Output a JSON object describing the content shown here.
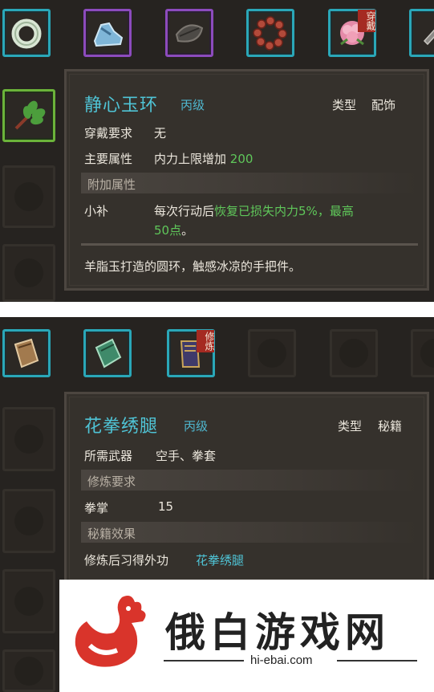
{
  "panel1": {
    "top_slots": [
      {
        "icon": "jade-ring-icon",
        "frame": "cyan"
      },
      {
        "icon": "blue-shoe-icon",
        "frame": "purple"
      },
      {
        "icon": "dark-stone-icon",
        "frame": "purple"
      },
      {
        "icon": "prayer-beads-icon",
        "frame": "cyan"
      },
      {
        "icon": "pink-flower-icon",
        "frame": "cyan",
        "tag": "穿戴"
      },
      {
        "icon": "gray-item-icon",
        "frame": "cyan"
      }
    ],
    "side_slots": [
      {
        "icon": "green-herb-icon",
        "frame": "green"
      },
      {
        "icon": "",
        "frame": "empty"
      },
      {
        "icon": "",
        "frame": "empty"
      }
    ],
    "tooltip": {
      "name": "静心玉环",
      "grade": "丙级",
      "type_label": "类型",
      "type_value": "配饰",
      "req_label": "穿戴要求",
      "req_value": "无",
      "main_attr_label": "主要属性",
      "main_attr_text": "内力上限增加",
      "main_attr_value": "200",
      "extra_header": "附加属性",
      "extra_name": "小补",
      "extra_desc_prefix": "每次行动后",
      "extra_desc_green1": "恢复已损失内力5%，最高",
      "extra_desc_green2": "50点",
      "extra_desc_suffix": "。",
      "description": "羊脂玉打造的圆环，触感冰凉的手把件。"
    }
  },
  "panel2": {
    "top_slots": [
      {
        "icon": "brown-book-icon",
        "frame": "cyan"
      },
      {
        "icon": "green-book-icon",
        "frame": "cyan"
      },
      {
        "icon": "purple-book-icon",
        "frame": "cyan",
        "tag": "修炼"
      },
      {
        "icon": "",
        "frame": "empty"
      },
      {
        "icon": "",
        "frame": "empty"
      },
      {
        "icon": "",
        "frame": "empty"
      }
    ],
    "tooltip": {
      "name": "花拳绣腿",
      "grade": "丙级",
      "type_label": "类型",
      "type_value": "秘籍",
      "weapon_label": "所需武器",
      "weapon_value": "空手、拳套",
      "train_header": "修炼要求",
      "train_skill": "拳掌",
      "train_value": "15",
      "effect_header": "秘籍效果",
      "effect_text": "修炼后习得外功",
      "effect_value": "花拳绣腿"
    }
  },
  "watermark": {
    "logo_text": "俄白游戏网",
    "domain": "hi-ebai.com",
    "logo_color": "#d9342b"
  }
}
